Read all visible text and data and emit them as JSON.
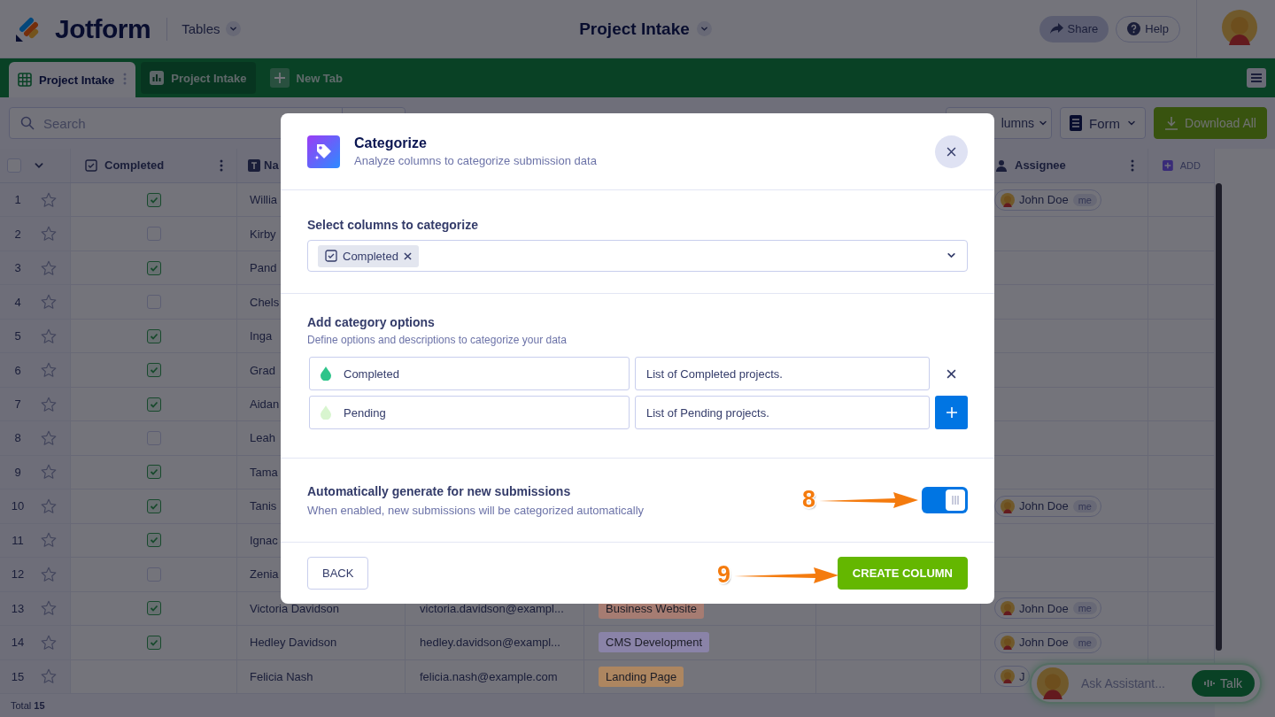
{
  "header": {
    "logo": "Jotform",
    "section": "Tables",
    "title": "Project Intake",
    "actions": [
      {
        "label": "Share",
        "kind": "share"
      },
      {
        "label": "Help",
        "kind": "help"
      }
    ]
  },
  "tabs": [
    {
      "label": "Project Intake",
      "kind": "grid",
      "selected": true
    },
    {
      "label": "Project Intake",
      "kind": "report",
      "selected": false
    },
    {
      "label": "New Tab",
      "kind": "add",
      "selected": false
    }
  ],
  "toolbar": {
    "search_placeholder": "Search",
    "buttons": [
      {
        "label": "lumns",
        "kind": "columns"
      },
      {
        "label": "Form",
        "kind": "form"
      },
      {
        "label": "Download All",
        "kind": "download"
      }
    ]
  },
  "table": {
    "columns": [
      {
        "label": "Completed",
        "kind": "checkbox"
      },
      {
        "label": "Na",
        "kind": "text"
      },
      {
        "label": "Assignee",
        "kind": "person"
      }
    ],
    "add_column": "ADD",
    "select_all_checked": false,
    "rows": [
      {
        "number": "1",
        "completed": true,
        "name": "Willia",
        "assignee": {
          "name": "John Doe",
          "badge": "me"
        }
      },
      {
        "number": "2",
        "completed": false,
        "name": "Kirby"
      },
      {
        "number": "3",
        "completed": true,
        "name": "Pand"
      },
      {
        "number": "4",
        "completed": false,
        "name": "Chels"
      },
      {
        "number": "5",
        "completed": true,
        "name": "Inga"
      },
      {
        "number": "6",
        "completed": true,
        "name": "Grad"
      },
      {
        "number": "7",
        "completed": true,
        "name": "Aidan"
      },
      {
        "number": "8",
        "completed": false,
        "name": "Leah"
      },
      {
        "number": "9",
        "completed": true,
        "name": "Tama"
      },
      {
        "number": "10",
        "completed": true,
        "name": "Tanis",
        "assignee": {
          "name": "John Doe",
          "badge": "me"
        }
      },
      {
        "number": "11",
        "completed": true,
        "name": "Ignac"
      },
      {
        "number": "12",
        "completed": false,
        "name": "Zenia"
      },
      {
        "number": "13",
        "completed": true,
        "name": "Victoria Davidson",
        "email": "victoria.davidson@exampl...",
        "tag": {
          "label": "Business Website",
          "color": "#a67c72"
        },
        "assignee": {
          "name": "John Doe",
          "badge": "me"
        }
      },
      {
        "number": "14",
        "completed": true,
        "name": "Hedley Davidson",
        "email": "hedley.davidson@exampl...",
        "tag": {
          "label": "CMS Development",
          "color": "#8a83a8"
        },
        "assignee": {
          "name": "John Doe",
          "badge": "me"
        }
      },
      {
        "number": "15",
        "name": "Felicia Nash",
        "email": "felicia.nash@example.com",
        "tag": {
          "label": "Landing Page",
          "color": "#ad8660"
        },
        "assignee": {
          "name": "J"
        }
      }
    ],
    "footer": "Total **15**"
  },
  "assistant": {
    "placeholder": "Ask Assistant...",
    "button": "Talk"
  },
  "dialog": {
    "title": "Categorize",
    "subtitle": "Analyze columns to categorize submission data",
    "columns_label": "Select columns to categorize",
    "selected_columns": [
      {
        "label": "Completed"
      }
    ],
    "options_title": "Add category options",
    "options_subtitle": "Define options and descriptions to categorize your data",
    "options": [
      {
        "name": "Completed",
        "description": "List of Completed projects.",
        "color": "#2ec48a",
        "kind": "remove"
      },
      {
        "name": "Pending",
        "description": "List of Pending projects.",
        "color": "#d8f5cf",
        "kind": "add"
      }
    ],
    "auto": {
      "title": "Automatically generate for new submissions",
      "subtitle": "When enabled, new submissions will be categorized automatically",
      "on": true
    },
    "buttons": [
      {
        "label": "BACK",
        "kind": "secondary"
      },
      {
        "label": "CREATE COLUMN",
        "kind": "primary"
      }
    ]
  },
  "annotations": [
    {
      "label": "8"
    },
    {
      "label": "9"
    }
  ]
}
